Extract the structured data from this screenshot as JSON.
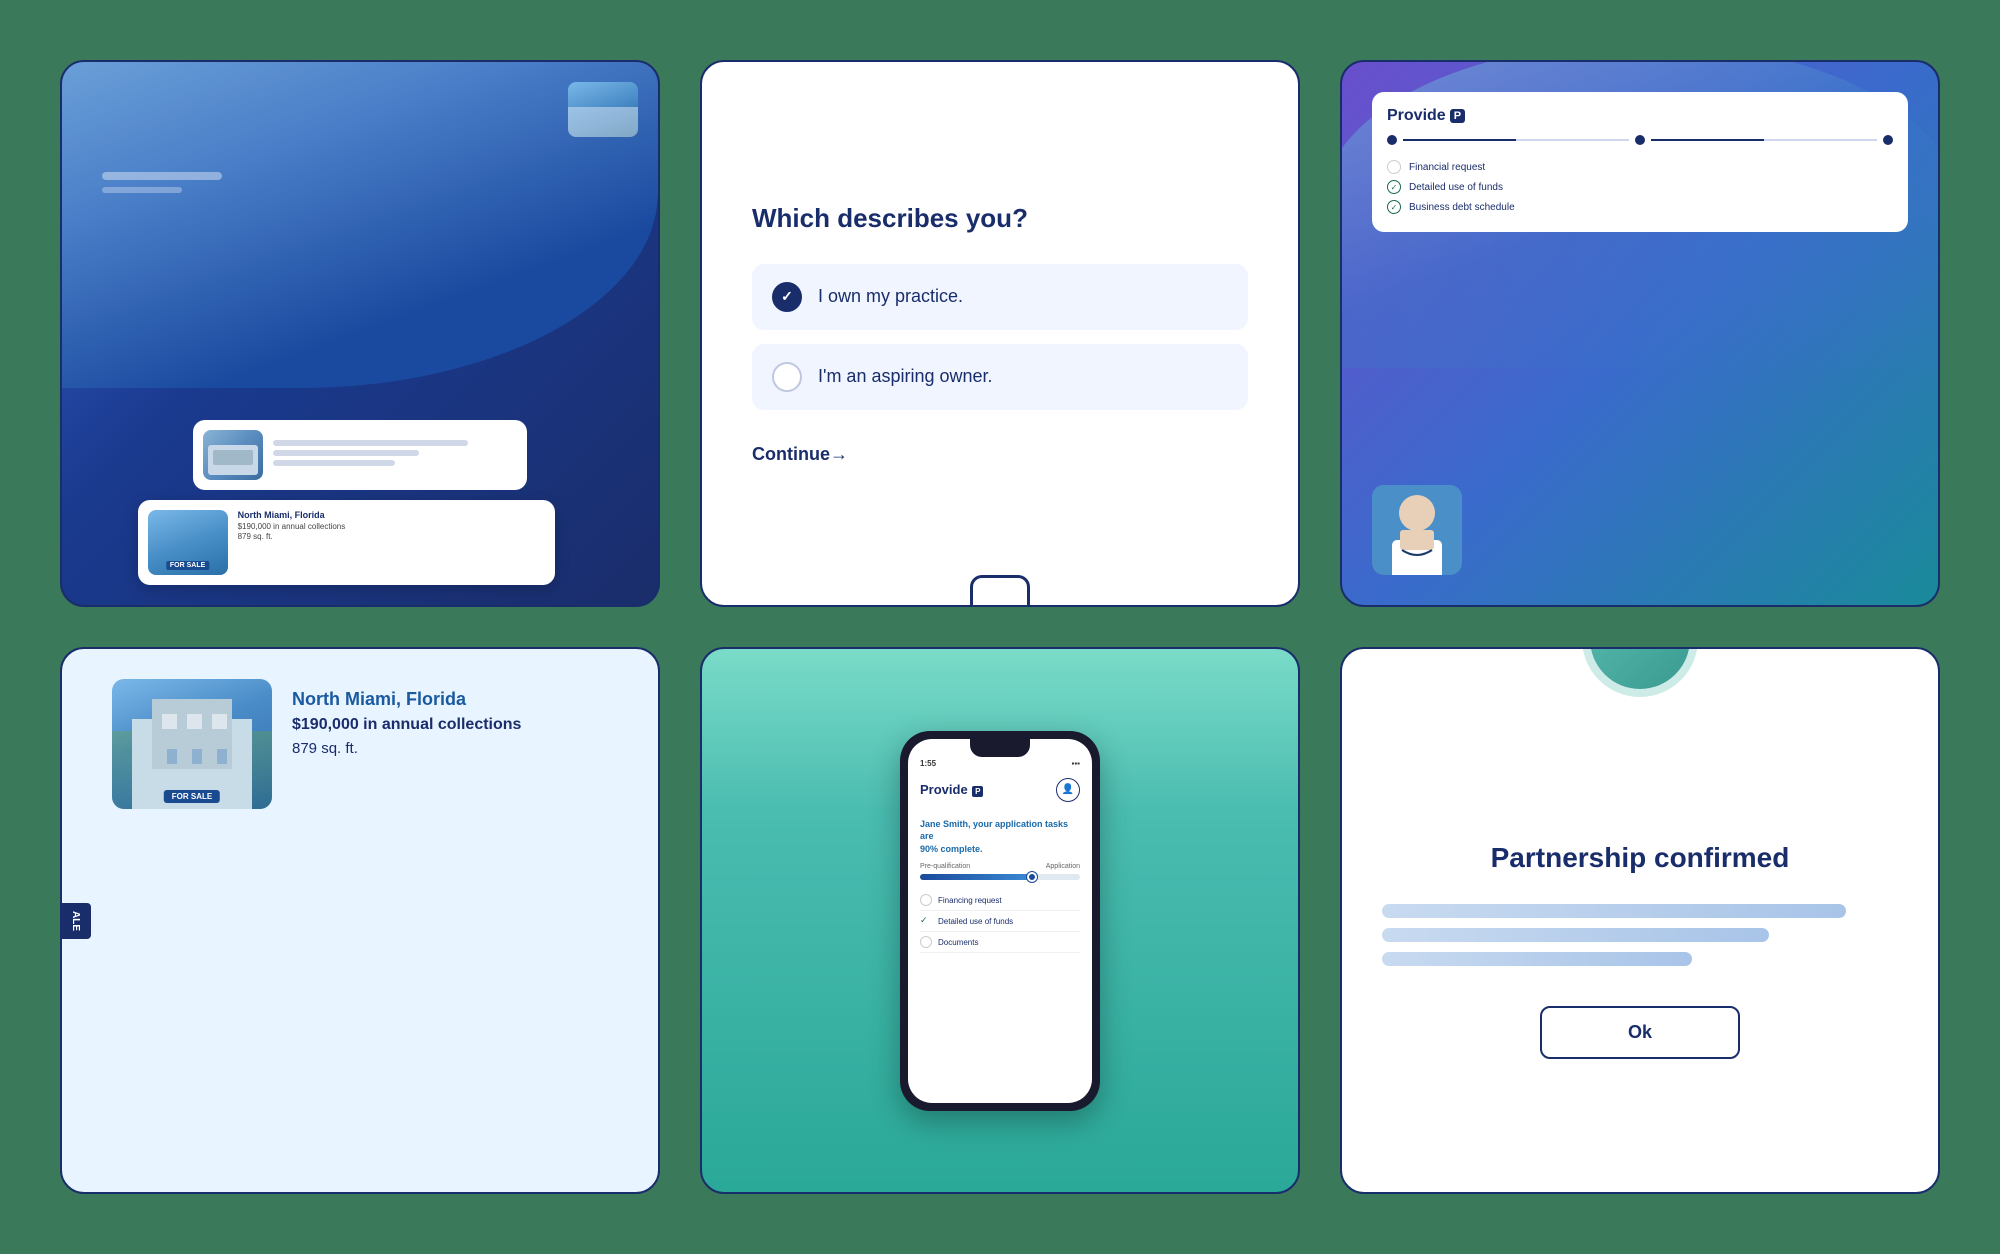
{
  "background_color": "#3a7a5a",
  "cards": {
    "card1": {
      "type": "property_listing_app",
      "property": {
        "city": "North Miami, Florida",
        "collections": "$190,000 in annual collections",
        "sqft": "879 sq. ft."
      }
    },
    "card2": {
      "title": "Which describes you?",
      "options": [
        {
          "id": "own",
          "label": "I own my practice.",
          "checked": true
        },
        {
          "id": "aspiring",
          "label": "I'm an aspiring owner.",
          "checked": false
        }
      ],
      "continue_label": "Continue→"
    },
    "card3": {
      "app_name": "Provide",
      "app_badge": "P",
      "checklist": [
        {
          "label": "Financial request",
          "done": false
        },
        {
          "label": "Detailed use of funds",
          "done": true
        },
        {
          "label": "Business debt schedule",
          "done": true
        }
      ]
    },
    "card4": {
      "badge": "ALE",
      "city": "North Miami, Florida",
      "collections": "$190,000 in annual collections",
      "sqft": "879 sq. ft.",
      "for_sale": "FOR SALE"
    },
    "card5": {
      "time": "1:55",
      "app_name": "Provide",
      "greeting": "Jane Smith, your application tasks are",
      "completion": "90% complete.",
      "progress_labels": {
        "left": "Pre-qualification",
        "right": "Application"
      },
      "tasks": [
        {
          "label": "Financing request",
          "done": false
        },
        {
          "label": "Detailed use of funds",
          "done": true
        },
        {
          "label": "Documents",
          "done": false
        }
      ]
    },
    "card6": {
      "title": "Partnership confirmed",
      "ok_label": "Ok"
    }
  }
}
